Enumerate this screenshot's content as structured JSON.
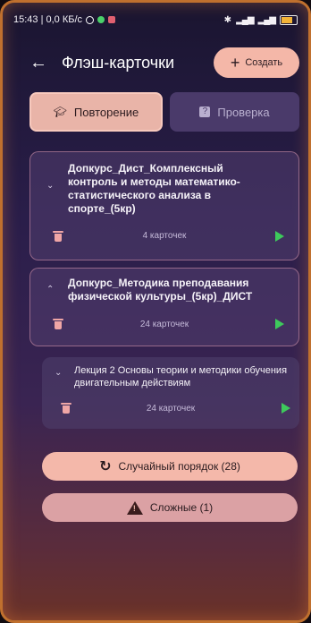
{
  "status_bar": {
    "time_info": "15:43 | 0,0 КБ/с",
    "right_icons": "bluetooth, signal, 4G signal, battery"
  },
  "appbar": {
    "title": "Флэш-карточки",
    "create_label": "Создать"
  },
  "modes": {
    "review_label": "Повторение",
    "test_label": "Проверка"
  },
  "decks": [
    {
      "title": "Допкурс_Дист_Комплексный контроль и методы математико-статистического анализа в спорте_(5кр)",
      "count": "4 карточек",
      "expanded": false
    },
    {
      "title": "Допкурс_Методика преподавания физической культуры_(5кр)_ДИСТ",
      "count": "24 карточек",
      "expanded": true
    }
  ],
  "subdeck": {
    "title": "Лекция 2 Основы теории и методики обучения двигательным действиям",
    "count": "24 карточек"
  },
  "actions": {
    "random_label": "Случайный порядок (28)",
    "hard_label": "Сложные (1)"
  },
  "colors": {
    "accent": "#f4b8aa",
    "play": "#3ec95c",
    "trash": "#f0a6a6"
  }
}
